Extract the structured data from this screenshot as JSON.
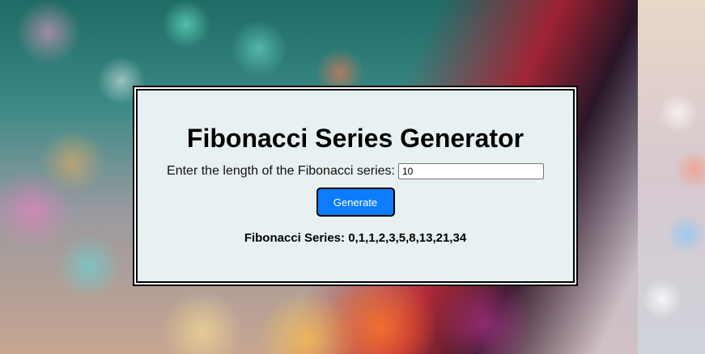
{
  "app": {
    "title": "Fibonacci Series Generator"
  },
  "form": {
    "length_label": "Enter the length of the Fibonacci series:",
    "length_value": "10",
    "generate_label": "Generate"
  },
  "result": {
    "label": "Fibonacci Series:",
    "values": "0,1,1,2,3,5,8,13,21,34"
  }
}
